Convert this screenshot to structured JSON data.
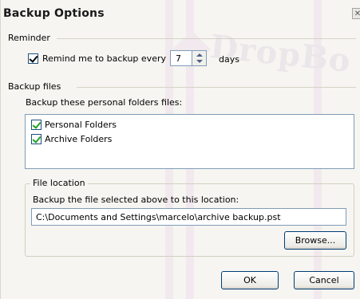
{
  "dialog": {
    "title": "Backup Options",
    "close_icon": "close-icon"
  },
  "reminder": {
    "section_label": "Reminder",
    "checkbox_label": "Remind me to backup every",
    "checked": true,
    "interval_value": "7",
    "unit_label": "days"
  },
  "backup_files": {
    "section_label": "Backup files",
    "list_label": "Backup these personal folders files:",
    "folders": [
      {
        "label": "Personal Folders",
        "checked": true
      },
      {
        "label": "Archive Folders",
        "checked": true
      }
    ]
  },
  "file_location": {
    "group_title": "File location",
    "instruction": "Backup the file selected above to this location:",
    "path_value": "C:\\Documents and Settings\\marcelo\\archive backup.pst",
    "browse_label": "Browse..."
  },
  "buttons": {
    "ok_label": "OK",
    "cancel_label": "Cancel"
  },
  "colors": {
    "dialog_bg": "#f6f5f1",
    "checkmark": "#21a121",
    "field_border": "#7f9db9",
    "button_border": "#003c74"
  }
}
